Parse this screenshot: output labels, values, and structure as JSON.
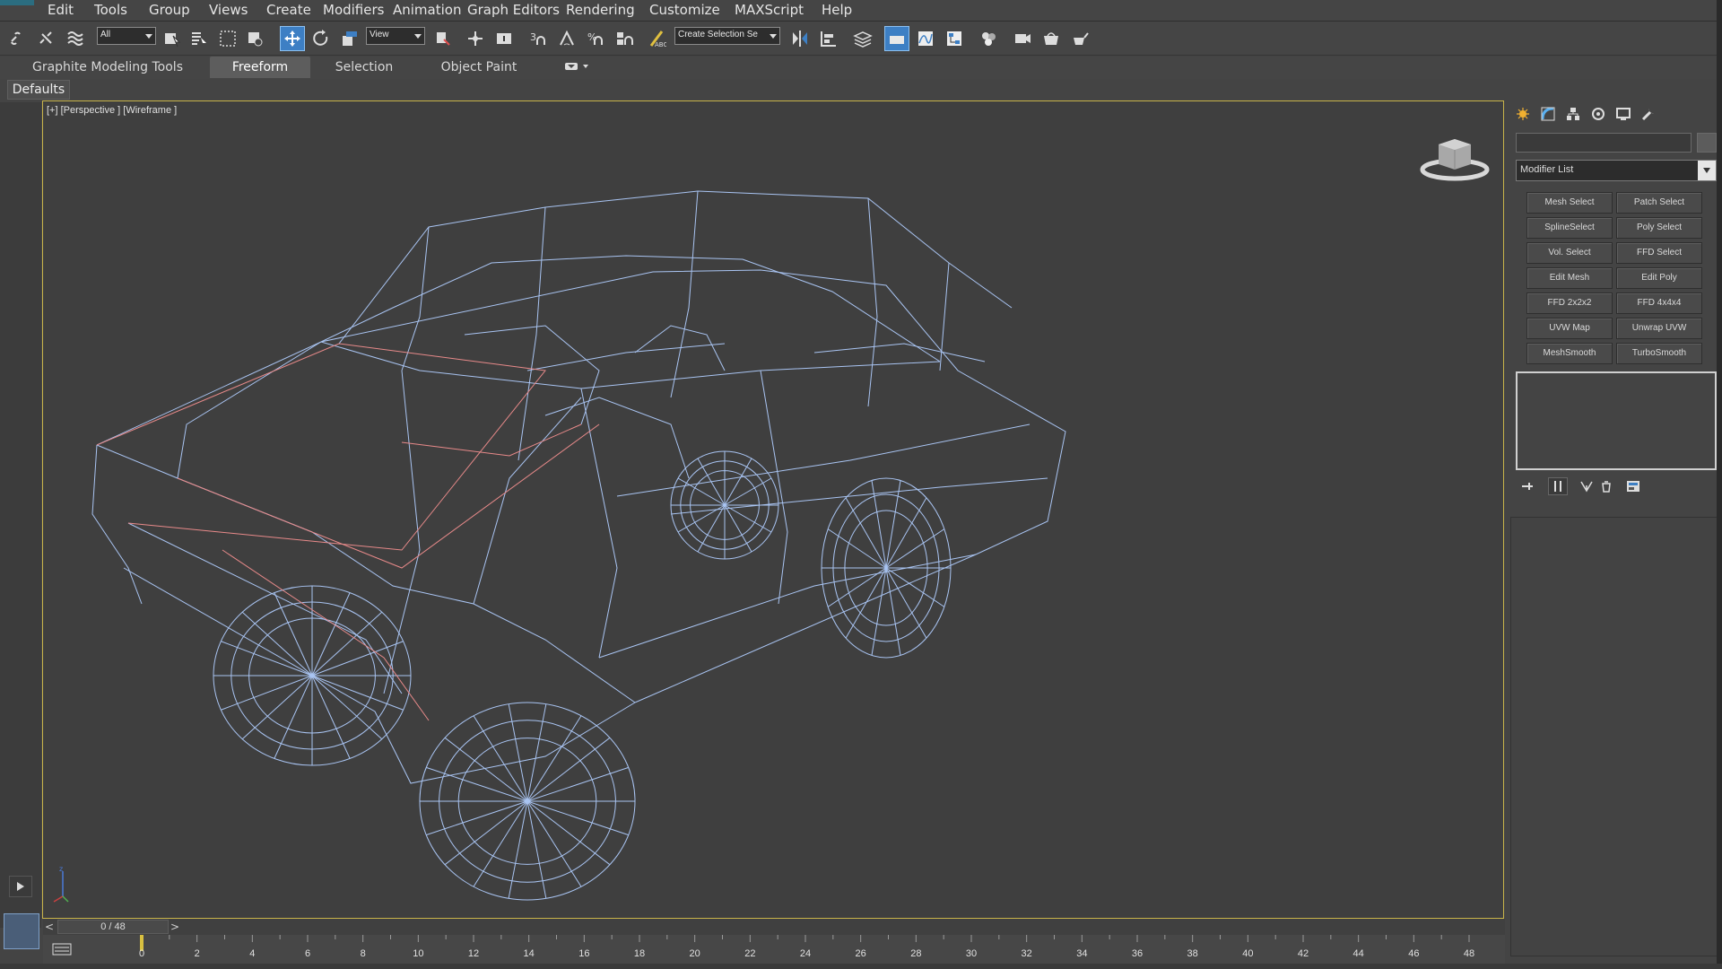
{
  "menu": {
    "items": [
      "Edit",
      "Tools",
      "Group",
      "Views",
      "Create",
      "Modifiers",
      "Animation",
      "Graph Editors",
      "Rendering",
      "Customize",
      "MAXScript",
      "Help"
    ]
  },
  "toolbar": {
    "selection_filter": "All",
    "reference_coord": "View",
    "named_selection": "Create Selection Se"
  },
  "ribbon": {
    "tabs": [
      "Graphite Modeling Tools",
      "Freeform",
      "Selection",
      "Object Paint"
    ],
    "selected_tab": "Freeform"
  },
  "defaults_tab": "Defaults",
  "viewport": {
    "label": "[+] [Perspective ] [Wireframe ]",
    "wire_colors": {
      "body": "#a9c4f2",
      "selected": "#e88a8a"
    }
  },
  "command_panel": {
    "tab_icons": [
      "create-icon",
      "modify-icon",
      "hierarchy-icon",
      "motion-icon",
      "display-icon",
      "utilities-icon"
    ],
    "object_name": "",
    "modifier_list": "Modifier List",
    "modifier_buttons": [
      "Mesh Select",
      "Patch Select",
      "SplineSelect",
      "Poly Select",
      "Vol. Select",
      "FFD Select",
      "Edit Mesh",
      "Edit Poly",
      "FFD 2x2x2",
      "FFD 4x4x4",
      "UVW Map",
      "Unwrap UVW",
      "MeshSmooth",
      "TurboSmooth"
    ],
    "stack_icons": [
      "pin-stack-icon",
      "show-end-result-icon",
      "make-unique-icon",
      "remove-modifier-icon",
      "configure-sets-icon"
    ]
  },
  "timeline": {
    "frame_display": "0 / 48",
    "prev": "<",
    "next": ">",
    "ticks": [
      "0",
      "2",
      "4",
      "6",
      "8",
      "10",
      "12",
      "14",
      "16",
      "18",
      "20",
      "22",
      "24",
      "26",
      "28",
      "30",
      "32",
      "34",
      "36",
      "38",
      "40",
      "42",
      "44",
      "46",
      "48"
    ]
  },
  "colors": {
    "accent": "#3d7fc4",
    "viewport_border": "#c8b44a",
    "background": "#444444"
  }
}
